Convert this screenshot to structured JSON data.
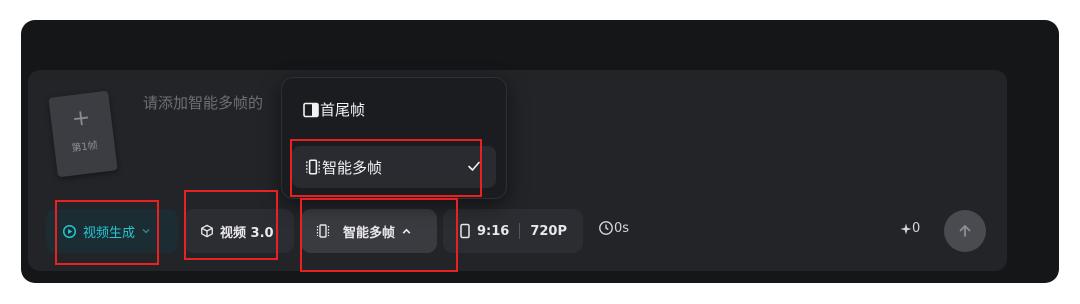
{
  "composer": {
    "placeholder": "请添加智能多帧的",
    "frame_card": {
      "plus": "+",
      "label": "第1帧"
    }
  },
  "toolbar": {
    "mode_label": "视频生成",
    "model_label": "视频 3.0",
    "frames_label": "智能多帧",
    "ratio_label": "9:16",
    "resolution_label": "720P",
    "duration_label": "0s",
    "credits_count": "0"
  },
  "dropdown": {
    "items": [
      {
        "label": "首尾帧",
        "icon": "first-last-frame-icon",
        "selected": false
      },
      {
        "label": "智能多帧",
        "icon": "multi-frame-icon",
        "selected": true
      }
    ]
  },
  "colors": {
    "accent": "#22c7d3",
    "highlight": "#e82222",
    "panel_bg": "#151618",
    "composer_bg": "#232428"
  }
}
